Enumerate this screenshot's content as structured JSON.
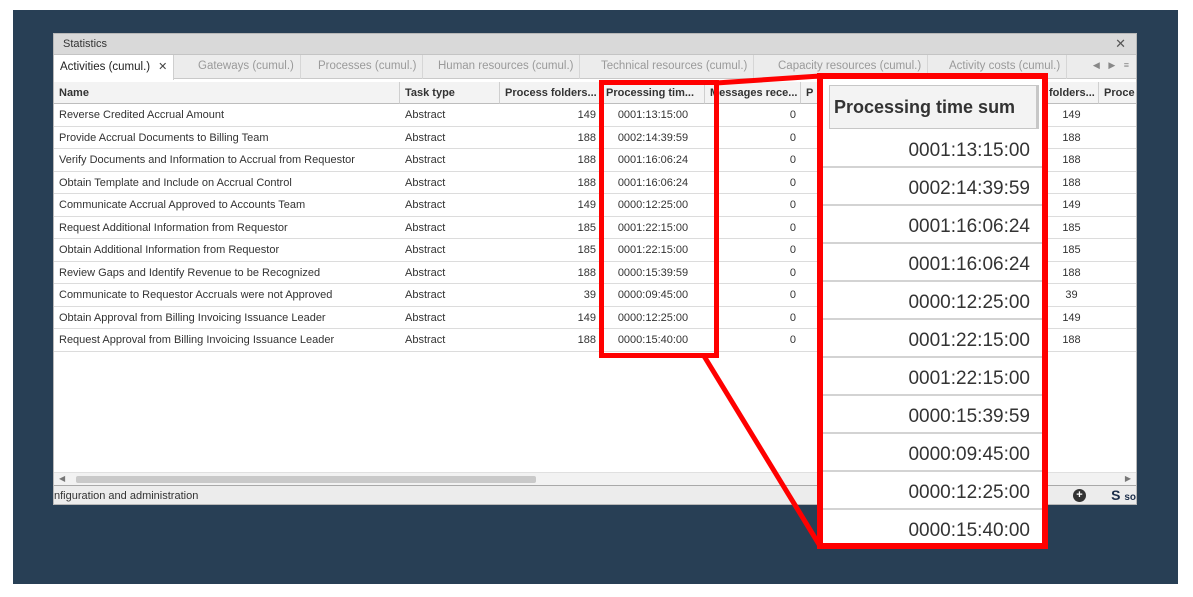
{
  "window": {
    "title": "Statistics",
    "close_icon": "close-icon"
  },
  "tabs": [
    {
      "label": "Activities (cumul.)",
      "active": true
    },
    {
      "label": "Gateways (cumul.)",
      "active": false
    },
    {
      "label": "Processes (cumul.)",
      "active": false
    },
    {
      "label": "Human resources (cumul.)",
      "active": false
    },
    {
      "label": "Technical resources (cumul.)",
      "active": false
    },
    {
      "label": "Capacity resources (cumul.)",
      "active": false
    },
    {
      "label": "Activity costs (cumul.)",
      "active": false
    }
  ],
  "tab_nav": "◀ ▶ ≡",
  "table": {
    "columns": [
      "Name",
      "Task type",
      "Process folders...",
      "Processing tim...",
      "Messages rece...",
      "P"
    ],
    "right_columns": [
      "folders...",
      "Proce"
    ],
    "rows": [
      {
        "name": "Reverse Credited Accrual Amount",
        "task_type": "Abstract",
        "process_folders": "149",
        "processing_time": "0001:13:15:00",
        "messages": "0",
        "folders": "149"
      },
      {
        "name": "Provide Accrual Documents to Billing Team",
        "task_type": "Abstract",
        "process_folders": "188",
        "processing_time": "0002:14:39:59",
        "messages": "0",
        "folders": "188"
      },
      {
        "name": "Verify Documents and Information to Accrual from Requestor",
        "task_type": "Abstract",
        "process_folders": "188",
        "processing_time": "0001:16:06:24",
        "messages": "0",
        "folders": "188"
      },
      {
        "name": "Obtain Template and Include on Accrual Control",
        "task_type": "Abstract",
        "process_folders": "188",
        "processing_time": "0001:16:06:24",
        "messages": "0",
        "folders": "188"
      },
      {
        "name": "Communicate Accrual Approved to Accounts Team",
        "task_type": "Abstract",
        "process_folders": "149",
        "processing_time": "0000:12:25:00",
        "messages": "0",
        "folders": "149"
      },
      {
        "name": "Request Additional Information from Requestor",
        "task_type": "Abstract",
        "process_folders": "185",
        "processing_time": "0001:22:15:00",
        "messages": "0",
        "folders": "185"
      },
      {
        "name": "Obtain Additional Information from Requestor",
        "task_type": "Abstract",
        "process_folders": "185",
        "processing_time": "0001:22:15:00",
        "messages": "0",
        "folders": "185"
      },
      {
        "name": "Review Gaps and Identify Revenue to be Recognized",
        "task_type": "Abstract",
        "process_folders": "188",
        "processing_time": "0000:15:39:59",
        "messages": "0",
        "folders": "188"
      },
      {
        "name": "Communicate to Requestor Accruals were not Approved",
        "task_type": "Abstract",
        "process_folders": "39",
        "processing_time": "0000:09:45:00",
        "messages": "0",
        "folders": "39"
      },
      {
        "name": "Obtain Approval from  Billing Invoicing Issuance Leader",
        "task_type": "Abstract",
        "process_folders": "149",
        "processing_time": "0000:12:25:00",
        "messages": "0",
        "folders": "149"
      },
      {
        "name": "Request Approval from  Billing Invoicing Issuance  Leader",
        "task_type": "Abstract",
        "process_folders": "188",
        "processing_time": "0000:15:40:00",
        "messages": "0",
        "folders": "188"
      }
    ]
  },
  "statusbar": {
    "text": "nfiguration and administration",
    "logo_text": "S",
    "logo_suffix": "so"
  },
  "callout": {
    "header": "Processing time sum",
    "values": [
      "0001:13:15:00",
      "0002:14:39:59",
      "0001:16:06:24",
      "0001:16:06:24",
      "0000:12:25:00",
      "0001:22:15:00",
      "0001:22:15:00",
      "0000:15:39:59",
      "0000:09:45:00",
      "0000:12:25:00",
      "0000:15:40:00"
    ]
  },
  "colors": {
    "backdrop": "#283f55",
    "highlight": "#ff0000"
  }
}
